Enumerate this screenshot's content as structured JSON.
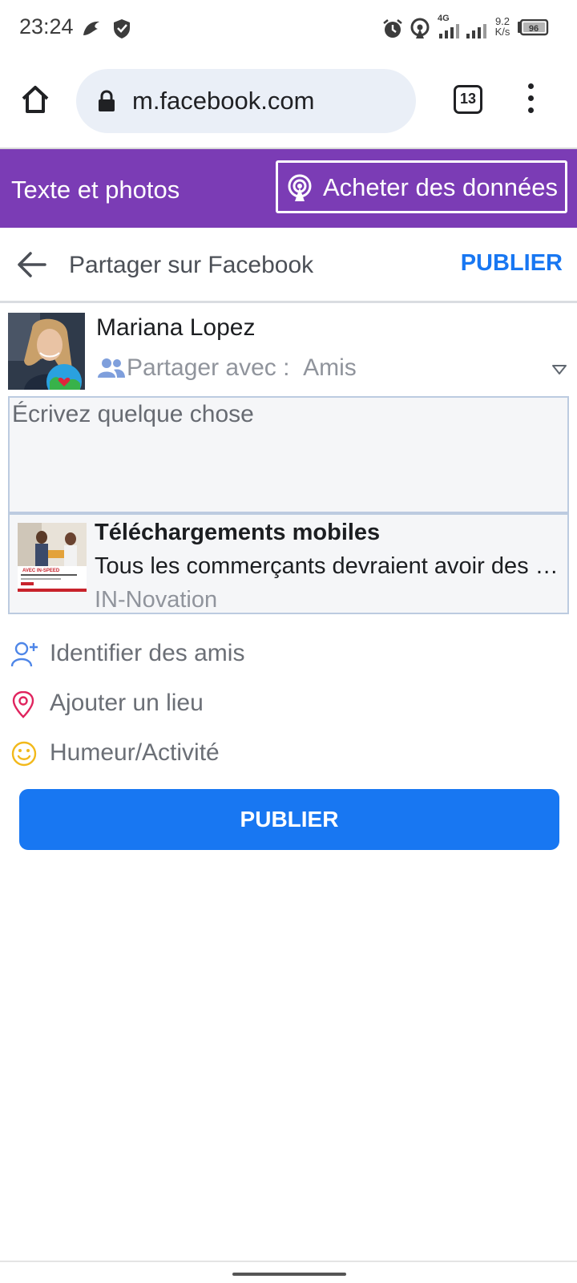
{
  "status_bar": {
    "time": "23:24",
    "network_type": "4G",
    "speed_value": "9.2",
    "speed_unit": "K/s",
    "battery": "96",
    "icons": [
      "app-notification-icon",
      "vpn-shield-icon",
      "alarm-icon",
      "hotspot-icon",
      "signal-icon",
      "signal-icon",
      "battery-icon"
    ]
  },
  "browser": {
    "url": "m.facebook.com",
    "tab_count": "13"
  },
  "banner": {
    "title": "Texte et photos",
    "buy_label": "Acheter des données",
    "background": "#7b3cb5"
  },
  "share_header": {
    "title": "Partager sur Facebook",
    "publish_label": "PUBLIER"
  },
  "author": {
    "name": "Mariana Lopez",
    "audience_label": "Partager avec :",
    "audience_value": "Amis"
  },
  "composer": {
    "placeholder": "Écrivez quelque chose"
  },
  "link_preview": {
    "title": "Téléchargements mobiles",
    "description": "Tous les commerçants devraient avoir des solutions mobiles",
    "source": "IN-Novation",
    "thumbnail_caption": "AVEC IN-SPEED"
  },
  "actions": [
    {
      "label": "Identifier des amis",
      "icon": "tag-friends-icon"
    },
    {
      "label": "Ajouter un lieu",
      "icon": "location-pin-icon"
    },
    {
      "label": "Humeur/Activité",
      "icon": "smiley-icon"
    }
  ],
  "publish_button": {
    "label": "PUBLIER",
    "color": "#1877f2"
  }
}
